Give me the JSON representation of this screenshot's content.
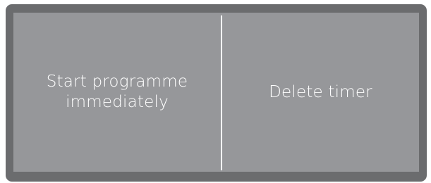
{
  "options": {
    "start_now": {
      "line1": "Start programme",
      "line2": "immediately"
    },
    "delete_timer": {
      "label": "Delete timer"
    }
  },
  "colors": {
    "frame": "#6b6c6e",
    "screen": "#96979a",
    "text": "#ffffff"
  }
}
